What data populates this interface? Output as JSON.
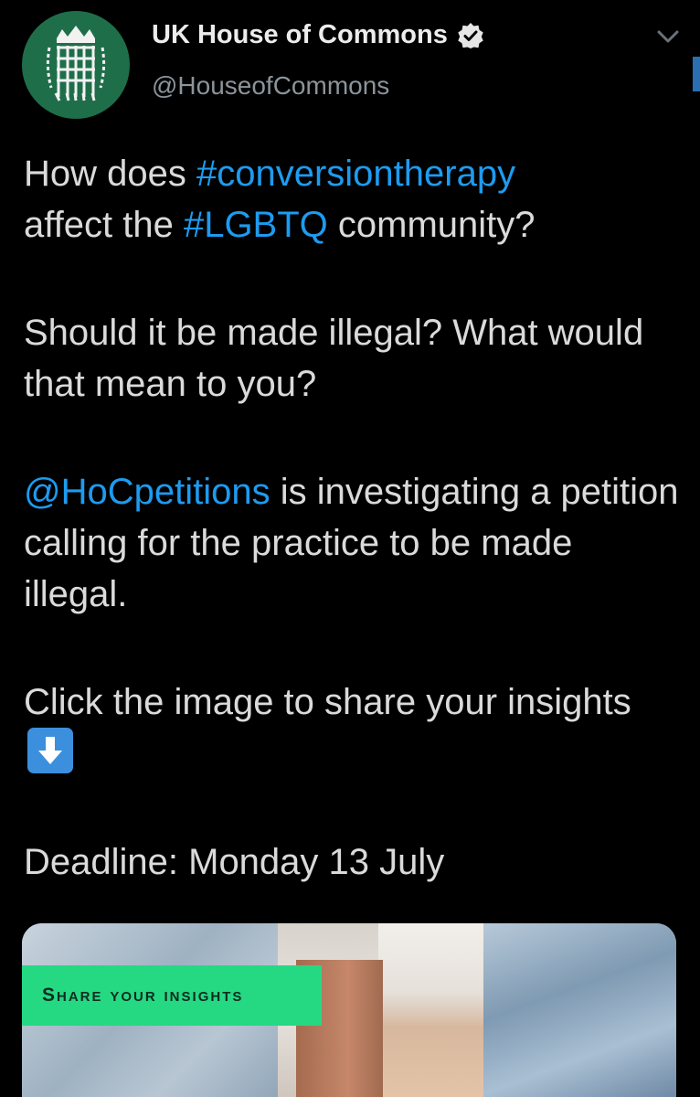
{
  "account": {
    "display_name": "UK House of Commons",
    "handle": "@HouseofCommons",
    "verified": true
  },
  "icons": {
    "avatar": "portcullis-logo",
    "verified": "verified-badge-icon",
    "menu": "chevron-down-icon",
    "emoji": "down-arrow-emoji"
  },
  "tweet": {
    "line1_pre": "How does ",
    "line1_tag": "#conversiontherapy",
    "line2_pre": "affect the ",
    "line2_tag": "#LGBTQ",
    "line2_post": " community?",
    "para2": "Should it be made illegal? What would that mean to you?",
    "para3_mention": "@HoCpetitions",
    "para3_post": " is investigating a petition calling for the practice to be made illegal.",
    "para4": "Click the image to share your insights",
    "para5": "Deadline: Monday 13 July"
  },
  "media": {
    "badge_text": "Share your insights"
  },
  "colors": {
    "background": "#000000",
    "link": "#1d9bf0",
    "avatar": "#1f6e4a",
    "badge": "#25d982"
  }
}
